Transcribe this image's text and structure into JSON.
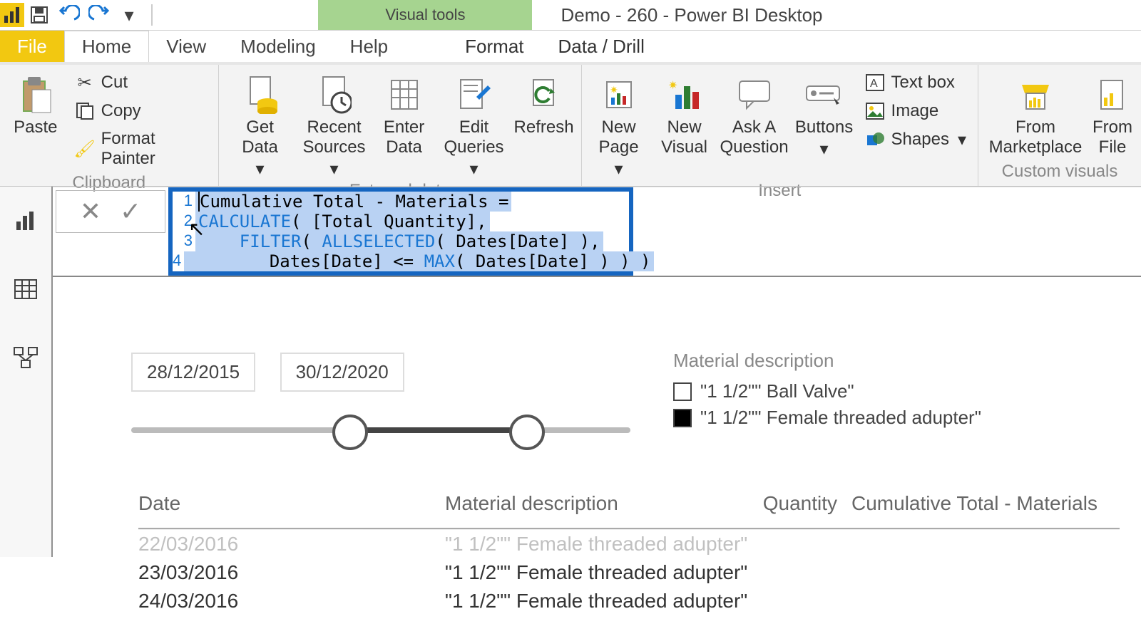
{
  "title": "Demo - 260  -  Power BI Desktop",
  "contextual_tab": "Visual tools",
  "tabs": {
    "file": "File",
    "home": "Home",
    "view": "View",
    "modeling": "Modeling",
    "help": "Help",
    "format": "Format",
    "data_drill": "Data / Drill"
  },
  "ribbon": {
    "clipboard": {
      "paste": "Paste",
      "cut": "Cut",
      "copy": "Copy",
      "format_painter": "Format Painter",
      "label": "Clipboard"
    },
    "external": {
      "get_data": "Get\nData",
      "recent": "Recent\nSources",
      "enter": "Enter\nData",
      "edit": "Edit\nQueries",
      "refresh": "Refresh",
      "label": "External data"
    },
    "insert": {
      "new_page": "New\nPage",
      "new_visual": "New\nVisual",
      "ask": "Ask A\nQuestion",
      "buttons": "Buttons",
      "textbox": "Text box",
      "image": "Image",
      "shapes": "Shapes",
      "label": "Insert"
    },
    "custom": {
      "marketplace": "From\nMarketplace",
      "file": "From\nFile",
      "label": "Custom visuals"
    }
  },
  "formula": {
    "lines": [
      "Cumulative Total - Materials =",
      "CALCULATE( [Total Quantity],",
      "    FILTER( ALLSELECTED( Dates[Date] ),",
      "        Dates[Date] <= MAX( Dates[Date] ) ) )"
    ],
    "line_numbers": [
      "1",
      "2",
      "3",
      "4"
    ]
  },
  "slicer": {
    "start": "28/12/2015",
    "end": "30/12/2020"
  },
  "legend": {
    "title": "Material description",
    "items": [
      {
        "label": "\"1 1/2\"\" Ball Valve\"",
        "filled": false
      },
      {
        "label": "\"1 1/2\"\" Female threaded adupter\"",
        "filled": true
      }
    ]
  },
  "table": {
    "headers": {
      "date": "Date",
      "mat": "Material description",
      "qty": "Quantity",
      "cum": "Cumulative Total - Materials"
    },
    "rows": [
      {
        "date": "22/03/2016",
        "mat": "\"1 1/2\"\" Female threaded adupter\""
      },
      {
        "date": "23/03/2016",
        "mat": "\"1 1/2\"\" Female threaded adupter\""
      },
      {
        "date": "24/03/2016",
        "mat": "\"1 1/2\"\" Female threaded adupter\""
      }
    ]
  }
}
